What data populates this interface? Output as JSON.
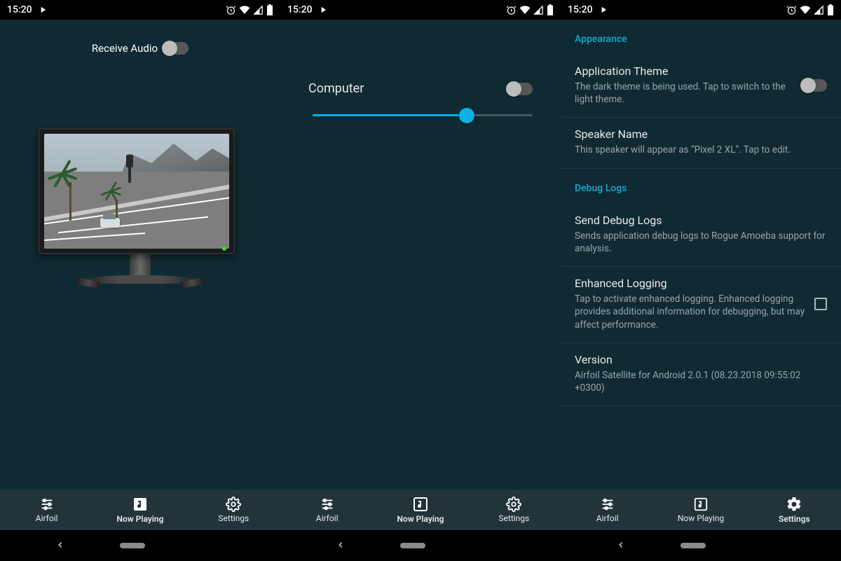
{
  "status": {
    "time": "15:20"
  },
  "panel1": {
    "receive_audio_label": "Receive Audio",
    "receive_audio_on": false
  },
  "panel2": {
    "speaker_label": "Computer",
    "speaker_toggle_on": false,
    "volume_percent": 70
  },
  "panel3": {
    "sections": {
      "appearance_header": "Appearance",
      "debug_header": "Debug Logs"
    },
    "theme": {
      "title": "Application Theme",
      "sub": "The dark theme is being used. Tap to switch to the light theme.",
      "on": false
    },
    "speaker_name": {
      "title": "Speaker Name",
      "sub": "This speaker will appear as “Pixel 2 XL”. Tap to edit."
    },
    "send_logs": {
      "title": "Send Debug Logs",
      "sub": "Sends application debug logs to Rogue Amoeba support for analysis."
    },
    "enhanced_logging": {
      "title": "Enhanced Logging",
      "sub": "Tap to activate enhanced logging. Enhanced logging provides additional information for debugging, but may affect performance.",
      "checked": false
    },
    "version": {
      "title": "Version",
      "sub": "Airfoil Satellite for Android 2.0.1 (08.23.2018 09:55:02 +0300)"
    }
  },
  "tabs": {
    "airfoil": "Airfoil",
    "now_playing": "Now Playing",
    "settings": "Settings"
  },
  "active_tab": {
    "p1": "now_playing",
    "p2": "now_playing",
    "p3": "settings"
  }
}
